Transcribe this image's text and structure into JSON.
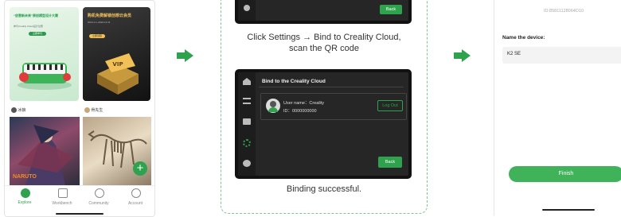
{
  "phone1": {
    "banner_left": {
      "title_line1": "“创意新未来”原创模型设计大赛",
      "subtitle": "参与Creality Cloud设计比赛",
      "button": "立即参与"
    },
    "banner_right": {
      "title": "购机免费解锁创想云会员",
      "date": "2024.1.1~2024.12.31",
      "button": "立即领取",
      "badge": "VIP"
    },
    "feed": [
      {
        "user": "冰狼",
        "watermark": "NARUTO"
      },
      {
        "user": "骨先生"
      }
    ],
    "fab_label": "+",
    "nav": [
      {
        "label": "Explore",
        "icon": "explore-icon",
        "active": true
      },
      {
        "label": "Workbench",
        "icon": "workbench-icon",
        "active": false
      },
      {
        "label": "Community",
        "icon": "community-icon",
        "active": false
      },
      {
        "label": "Account",
        "icon": "account-icon",
        "active": false
      }
    ]
  },
  "panel2": {
    "screen1": {
      "button": "Back"
    },
    "caption1": "Click Settings → Bind to Creality Cloud, scan the QR code",
    "caption1_line1": "Click Settings → Bind to Creality Cloud,",
    "caption1_line2": "scan the QR code",
    "screen2": {
      "title": "Bind to the Creality Cloud",
      "user_name": "User name：Creality",
      "user_id": "ID：0000000000",
      "logout": "Log Out",
      "back": "Back"
    },
    "caption2": "Binding successful."
  },
  "phone3": {
    "device_id": "ID:85811128064D10",
    "name_label": "Name the device:",
    "name_value": "K2 SE",
    "finish": "Finish"
  },
  "colors": {
    "accent": "#2fa24e",
    "screen_bg": "#262626",
    "dashed_border": "#7cc98f"
  }
}
